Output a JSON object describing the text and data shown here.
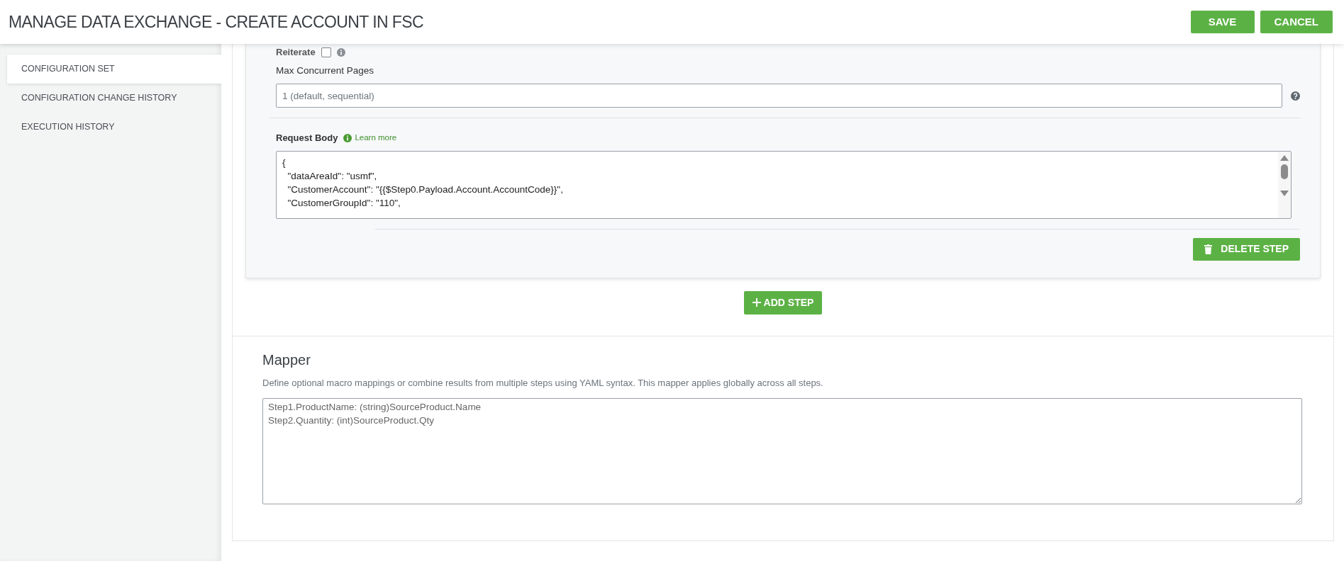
{
  "header": {
    "title": "MANAGE DATA EXCHANGE - CREATE ACCOUNT IN FSC",
    "buttons": [
      "SAVE",
      "CANCEL"
    ]
  },
  "sidebar": {
    "items": [
      {
        "label": "CONFIGURATION SET",
        "selected": true
      },
      {
        "label": "CONFIGURATION CHANGE HISTORY",
        "selected": false
      },
      {
        "label": "EXECUTION HISTORY",
        "selected": false
      }
    ]
  },
  "step": {
    "reiterate": {
      "label": "Reiterate",
      "checked": false
    },
    "max_pages": {
      "label": "Max Concurrent Pages",
      "placeholder": "1 (default, sequential)"
    },
    "request_body": {
      "label": "Request Body",
      "link": "Learn more",
      "lines": [
        "{",
        "  \"dataAreaId\": \"usmf\",",
        "  \"CustomerAccount\": \"{{$Step0.Payload.Account.AccountCode}}\",",
        "  \"CustomerGroupId\": \"110\","
      ]
    },
    "delete_button": "DELETE STEP"
  },
  "add_step_button": "ADD STEP",
  "mapper": {
    "title": "Mapper",
    "description": "Define optional macro mappings or combine results from multiple steps using YAML syntax. This mapper applies globally across all steps.",
    "placeholder": "Step1.ProductName: (string)SourceProduct.Name\nStep2.Quantity: (int)SourceProduct.Qty"
  }
}
